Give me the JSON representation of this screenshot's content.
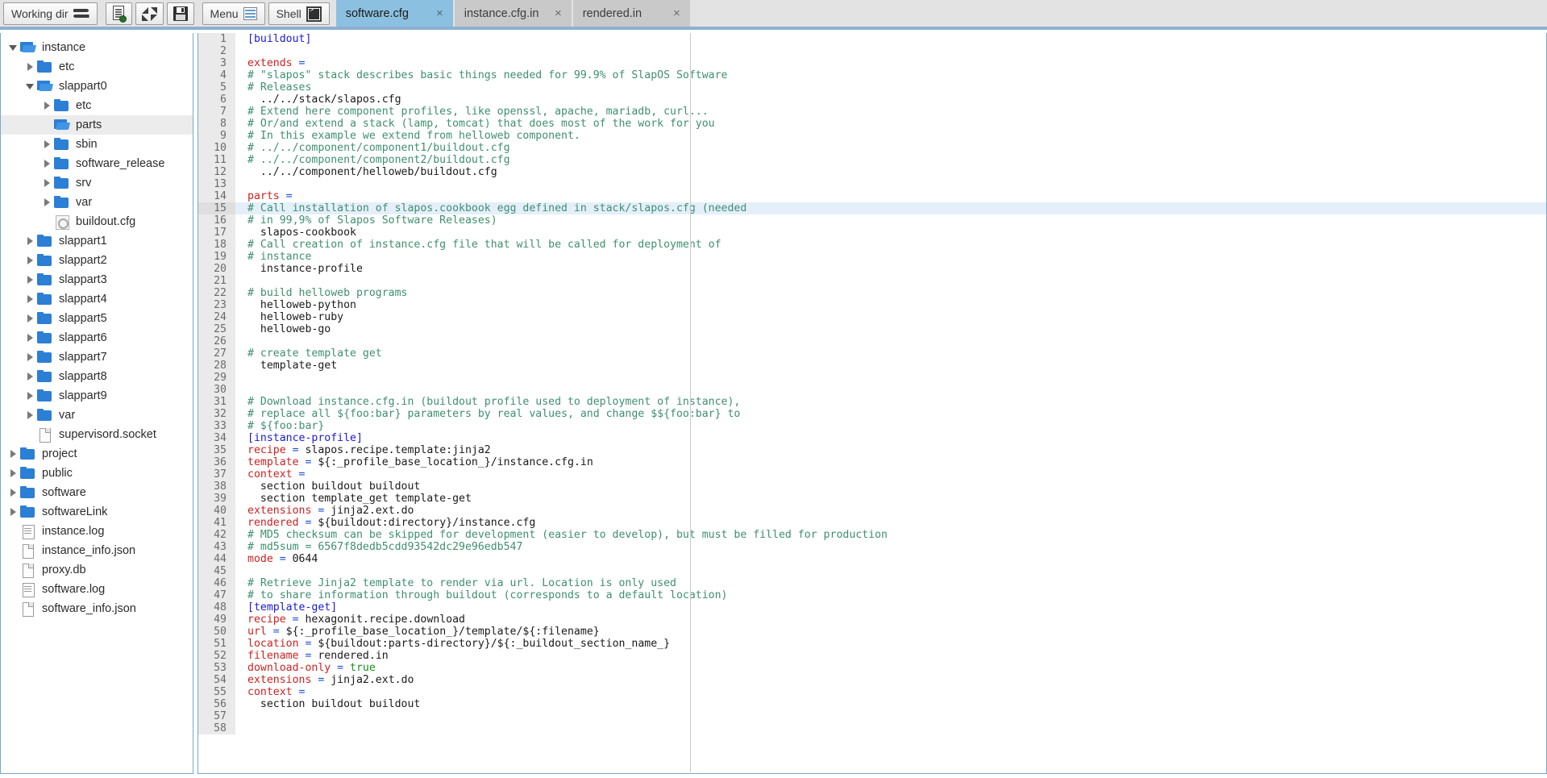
{
  "toolbar": {
    "working_dir_label": "Working dir",
    "working_dir_icon": "swap-arrows-icon",
    "doc_button_icon": "document-check-icon",
    "collapse_button_icon": "collapse-arrows-icon",
    "save_button_icon": "floppy-save-icon",
    "menu_label": "Menu",
    "menu_icon": "list-menu-icon",
    "shell_label": "Shell",
    "shell_icon": "terminal-icon"
  },
  "tabs": [
    {
      "label": "software.cfg",
      "close": "×",
      "active": true
    },
    {
      "label": "instance.cfg.in",
      "close": "×",
      "active": false
    },
    {
      "label": "rendered.in",
      "close": "×",
      "active": false
    }
  ],
  "sidebar": {
    "items": [
      {
        "label": "instance",
        "depth": 0,
        "icon": "folder-open",
        "twisty": "open",
        "selected": false
      },
      {
        "label": "etc",
        "depth": 1,
        "icon": "folder",
        "twisty": "closed",
        "selected": false
      },
      {
        "label": "slappart0",
        "depth": 1,
        "icon": "folder-open",
        "twisty": "open",
        "selected": false
      },
      {
        "label": "etc",
        "depth": 2,
        "icon": "folder",
        "twisty": "closed",
        "selected": false
      },
      {
        "label": "parts",
        "depth": 2,
        "icon": "folder-open",
        "twisty": "none",
        "selected": true
      },
      {
        "label": "sbin",
        "depth": 2,
        "icon": "folder",
        "twisty": "closed",
        "selected": false
      },
      {
        "label": "software_release",
        "depth": 2,
        "icon": "folder",
        "twisty": "closed",
        "selected": false
      },
      {
        "label": "srv",
        "depth": 2,
        "icon": "folder",
        "twisty": "closed",
        "selected": false
      },
      {
        "label": "var",
        "depth": 2,
        "icon": "folder",
        "twisty": "closed",
        "selected": false
      },
      {
        "label": "buildout.cfg",
        "depth": 2,
        "icon": "file-cfg",
        "twisty": "none",
        "selected": false
      },
      {
        "label": "slappart1",
        "depth": 1,
        "icon": "folder",
        "twisty": "closed",
        "selected": false
      },
      {
        "label": "slappart2",
        "depth": 1,
        "icon": "folder",
        "twisty": "closed",
        "selected": false
      },
      {
        "label": "slappart3",
        "depth": 1,
        "icon": "folder",
        "twisty": "closed",
        "selected": false
      },
      {
        "label": "slappart4",
        "depth": 1,
        "icon": "folder",
        "twisty": "closed",
        "selected": false
      },
      {
        "label": "slappart5",
        "depth": 1,
        "icon": "folder",
        "twisty": "closed",
        "selected": false
      },
      {
        "label": "slappart6",
        "depth": 1,
        "icon": "folder",
        "twisty": "closed",
        "selected": false
      },
      {
        "label": "slappart7",
        "depth": 1,
        "icon": "folder",
        "twisty": "closed",
        "selected": false
      },
      {
        "label": "slappart8",
        "depth": 1,
        "icon": "folder",
        "twisty": "closed",
        "selected": false
      },
      {
        "label": "slappart9",
        "depth": 1,
        "icon": "folder",
        "twisty": "closed",
        "selected": false
      },
      {
        "label": "var",
        "depth": 1,
        "icon": "folder",
        "twisty": "closed",
        "selected": false
      },
      {
        "label": "supervisord.socket",
        "depth": 1,
        "icon": "file",
        "twisty": "none",
        "selected": false
      },
      {
        "label": "project",
        "depth": 0,
        "icon": "folder",
        "twisty": "closed",
        "selected": false
      },
      {
        "label": "public",
        "depth": 0,
        "icon": "folder",
        "twisty": "closed",
        "selected": false
      },
      {
        "label": "software",
        "depth": 0,
        "icon": "folder",
        "twisty": "closed",
        "selected": false
      },
      {
        "label": "softwareLink",
        "depth": 0,
        "icon": "folder",
        "twisty": "closed",
        "selected": false
      },
      {
        "label": "instance.log",
        "depth": 0,
        "icon": "file-lines",
        "twisty": "none",
        "selected": false
      },
      {
        "label": "instance_info.json",
        "depth": 0,
        "icon": "file",
        "twisty": "none",
        "selected": false
      },
      {
        "label": "proxy.db",
        "depth": 0,
        "icon": "file",
        "twisty": "none",
        "selected": false
      },
      {
        "label": "software.log",
        "depth": 0,
        "icon": "file-lines",
        "twisty": "none",
        "selected": false
      },
      {
        "label": "software_info.json",
        "depth": 0,
        "icon": "file",
        "twisty": "none",
        "selected": false
      }
    ]
  },
  "editor": {
    "active_line": 15,
    "lines": [
      {
        "n": 1,
        "tokens": [
          {
            "t": "section",
            "v": "[buildout]"
          }
        ]
      },
      {
        "n": 2,
        "tokens": []
      },
      {
        "n": 3,
        "tokens": [
          {
            "t": "key",
            "v": "extends"
          },
          {
            "t": "eq",
            "v": " ="
          }
        ]
      },
      {
        "n": 4,
        "tokens": [
          {
            "t": "com",
            "v": "# \"slapos\" stack describes basic things needed for 99.9% of SlapOS Software"
          }
        ]
      },
      {
        "n": 5,
        "tokens": [
          {
            "t": "com",
            "v": "# Releases"
          }
        ]
      },
      {
        "n": 6,
        "tokens": [
          {
            "t": "val",
            "v": "  ../../stack/slapos.cfg"
          }
        ]
      },
      {
        "n": 7,
        "tokens": [
          {
            "t": "com",
            "v": "# Extend here component profiles, like openssl, apache, mariadb, curl..."
          }
        ]
      },
      {
        "n": 8,
        "tokens": [
          {
            "t": "com",
            "v": "# Or/and extend a stack (lamp, tomcat) that does most of the work for you"
          }
        ]
      },
      {
        "n": 9,
        "tokens": [
          {
            "t": "com",
            "v": "# In this example we extend from helloweb component."
          }
        ]
      },
      {
        "n": 10,
        "tokens": [
          {
            "t": "com",
            "v": "# ../../component/component1/buildout.cfg"
          }
        ]
      },
      {
        "n": 11,
        "tokens": [
          {
            "t": "com",
            "v": "# ../../component/component2/buildout.cfg"
          }
        ]
      },
      {
        "n": 12,
        "tokens": [
          {
            "t": "val",
            "v": "  ../../component/helloweb/buildout.cfg"
          }
        ]
      },
      {
        "n": 13,
        "tokens": []
      },
      {
        "n": 14,
        "tokens": [
          {
            "t": "key",
            "v": "parts"
          },
          {
            "t": "eq",
            "v": " ="
          }
        ]
      },
      {
        "n": 15,
        "tokens": [
          {
            "t": "com",
            "v": "# Call installation of slapos.cookbook egg defined in stack/slapos.cfg (needed"
          }
        ]
      },
      {
        "n": 16,
        "tokens": [
          {
            "t": "com",
            "v": "# in 99,9% of Slapos Software Releases)"
          }
        ]
      },
      {
        "n": 17,
        "tokens": [
          {
            "t": "val",
            "v": "  slapos-cookbook"
          }
        ]
      },
      {
        "n": 18,
        "tokens": [
          {
            "t": "com",
            "v": "# Call creation of instance.cfg file that will be called for deployment of"
          }
        ]
      },
      {
        "n": 19,
        "tokens": [
          {
            "t": "com",
            "v": "# instance"
          }
        ]
      },
      {
        "n": 20,
        "tokens": [
          {
            "t": "val",
            "v": "  instance-profile"
          }
        ]
      },
      {
        "n": 21,
        "tokens": []
      },
      {
        "n": 22,
        "tokens": [
          {
            "t": "com",
            "v": "# build helloweb programs"
          }
        ]
      },
      {
        "n": 23,
        "tokens": [
          {
            "t": "val",
            "v": "  helloweb-python"
          }
        ]
      },
      {
        "n": 24,
        "tokens": [
          {
            "t": "val",
            "v": "  helloweb-ruby"
          }
        ]
      },
      {
        "n": 25,
        "tokens": [
          {
            "t": "val",
            "v": "  helloweb-go"
          }
        ]
      },
      {
        "n": 26,
        "tokens": []
      },
      {
        "n": 27,
        "tokens": [
          {
            "t": "com",
            "v": "# create template get"
          }
        ]
      },
      {
        "n": 28,
        "tokens": [
          {
            "t": "val",
            "v": "  template-get"
          }
        ]
      },
      {
        "n": 29,
        "tokens": []
      },
      {
        "n": 30,
        "tokens": []
      },
      {
        "n": 31,
        "tokens": [
          {
            "t": "com",
            "v": "# Download instance.cfg.in (buildout profile used to deployment of instance),"
          }
        ]
      },
      {
        "n": 32,
        "tokens": [
          {
            "t": "com",
            "v": "# replace all ${foo:bar} parameters by real values, and change $${foo:bar} to"
          }
        ]
      },
      {
        "n": 33,
        "tokens": [
          {
            "t": "com",
            "v": "# ${foo:bar}"
          }
        ]
      },
      {
        "n": 34,
        "tokens": [
          {
            "t": "section",
            "v": "[instance-profile]"
          }
        ]
      },
      {
        "n": 35,
        "tokens": [
          {
            "t": "key",
            "v": "recipe"
          },
          {
            "t": "eq",
            "v": " = "
          },
          {
            "t": "val",
            "v": "slapos.recipe.template:jinja2"
          }
        ]
      },
      {
        "n": 36,
        "tokens": [
          {
            "t": "key",
            "v": "template"
          },
          {
            "t": "eq",
            "v": " = "
          },
          {
            "t": "val",
            "v": "${:_profile_base_location_}/instance.cfg.in"
          }
        ]
      },
      {
        "n": 37,
        "tokens": [
          {
            "t": "key",
            "v": "context"
          },
          {
            "t": "eq",
            "v": " ="
          }
        ]
      },
      {
        "n": 38,
        "tokens": [
          {
            "t": "val",
            "v": "  section buildout buildout"
          }
        ]
      },
      {
        "n": 39,
        "tokens": [
          {
            "t": "val",
            "v": "  section template_get template-get"
          }
        ]
      },
      {
        "n": 40,
        "tokens": [
          {
            "t": "key",
            "v": "extensions"
          },
          {
            "t": "eq",
            "v": " = "
          },
          {
            "t": "val",
            "v": "jinja2.ext.do"
          }
        ]
      },
      {
        "n": 41,
        "tokens": [
          {
            "t": "key",
            "v": "rendered"
          },
          {
            "t": "eq",
            "v": " = "
          },
          {
            "t": "val",
            "v": "${buildout:directory}/instance.cfg"
          }
        ]
      },
      {
        "n": 42,
        "tokens": [
          {
            "t": "com",
            "v": "# MD5 checksum can be skipped for development (easier to develop), but must be filled for production"
          }
        ]
      },
      {
        "n": 43,
        "tokens": [
          {
            "t": "com",
            "v": "# md5sum = 6567f8dedb5cdd93542dc29e96edb547"
          }
        ]
      },
      {
        "n": 44,
        "tokens": [
          {
            "t": "key",
            "v": "mode"
          },
          {
            "t": "eq",
            "v": " = "
          },
          {
            "t": "num",
            "v": "0644"
          }
        ]
      },
      {
        "n": 45,
        "tokens": []
      },
      {
        "n": 46,
        "tokens": [
          {
            "t": "com",
            "v": "# Retrieve Jinja2 template to render via url. Location is only used"
          }
        ]
      },
      {
        "n": 47,
        "tokens": [
          {
            "t": "com",
            "v": "# to share information through buildout (corresponds to a default location)"
          }
        ]
      },
      {
        "n": 48,
        "tokens": [
          {
            "t": "section",
            "v": "[template-get]"
          }
        ]
      },
      {
        "n": 49,
        "tokens": [
          {
            "t": "key",
            "v": "recipe"
          },
          {
            "t": "eq",
            "v": " = "
          },
          {
            "t": "val",
            "v": "hexagonit.recipe.download"
          }
        ]
      },
      {
        "n": 50,
        "tokens": [
          {
            "t": "key",
            "v": "url"
          },
          {
            "t": "eq",
            "v": " = "
          },
          {
            "t": "val",
            "v": "${:_profile_base_location_}/template/${:filename}"
          }
        ]
      },
      {
        "n": 51,
        "tokens": [
          {
            "t": "key",
            "v": "location"
          },
          {
            "t": "eq",
            "v": " = "
          },
          {
            "t": "val",
            "v": "${buildout:parts-directory}/${:_buildout_section_name_}"
          }
        ]
      },
      {
        "n": 52,
        "tokens": [
          {
            "t": "key",
            "v": "filename"
          },
          {
            "t": "eq",
            "v": " = "
          },
          {
            "t": "val",
            "v": "rendered.in"
          }
        ]
      },
      {
        "n": 53,
        "tokens": [
          {
            "t": "key",
            "v": "download-only"
          },
          {
            "t": "eq",
            "v": " = "
          },
          {
            "t": "bool",
            "v": "true"
          }
        ]
      },
      {
        "n": 54,
        "tokens": [
          {
            "t": "key",
            "v": "extensions"
          },
          {
            "t": "eq",
            "v": " = "
          },
          {
            "t": "val",
            "v": "jinja2.ext.do"
          }
        ]
      },
      {
        "n": 55,
        "tokens": [
          {
            "t": "key",
            "v": "context"
          },
          {
            "t": "eq",
            "v": " ="
          }
        ]
      },
      {
        "n": 56,
        "tokens": [
          {
            "t": "val",
            "v": "  section buildout buildout"
          }
        ]
      },
      {
        "n": 57,
        "tokens": []
      },
      {
        "n": 58,
        "tokens": []
      }
    ]
  }
}
